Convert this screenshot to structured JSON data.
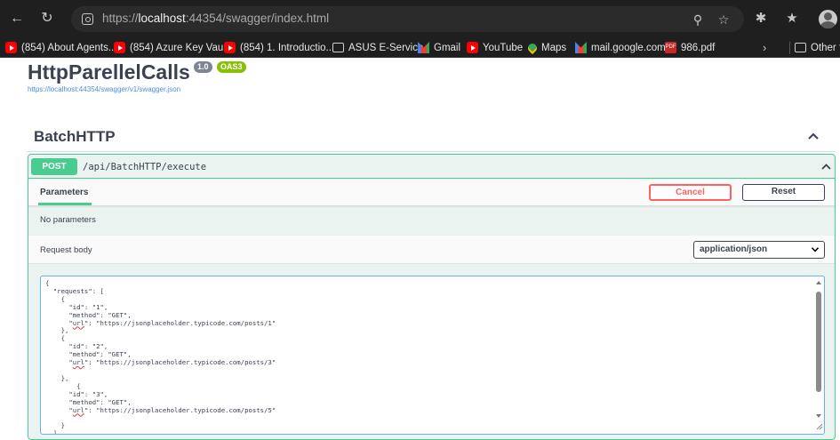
{
  "browser": {
    "url_scheme": "https://",
    "url_host": "localhost",
    "url_port": ":44354",
    "url_path": "/swagger/index.html",
    "bookmarks": [
      {
        "label": "(854) About Agents...",
        "icon": "youtube-icon"
      },
      {
        "label": "(854) Azure Key Vau...",
        "icon": "youtube-icon"
      },
      {
        "label": "(854) 1. Introductio...",
        "icon": "youtube-icon"
      },
      {
        "label": "ASUS E-Service",
        "icon": "folder-icon"
      },
      {
        "label": "Gmail",
        "icon": "gmail-icon"
      },
      {
        "label": "YouTube",
        "icon": "youtube-icon"
      },
      {
        "label": "Maps",
        "icon": "maps-icon"
      },
      {
        "label": "mail.google.com",
        "icon": "gmail-icon"
      },
      {
        "label": "986.pdf",
        "icon": "pdf-icon"
      },
      {
        "label": "Other fa",
        "icon": "folder-icon"
      }
    ]
  },
  "api": {
    "title": "HttpParellelCalls",
    "version": "1.0",
    "oas_badge": "OAS3",
    "spec_url": "https://localhost:44354/swagger/v1/swagger.json"
  },
  "tag": {
    "name": "BatchHTTP"
  },
  "operation": {
    "method": "POST",
    "path": "/api/BatchHTTP/execute",
    "parameters_tab": "Parameters",
    "cancel_label": "Cancel",
    "reset_label": "Reset",
    "no_params": "No parameters",
    "request_body_label": "Request body",
    "content_type": "application/json"
  },
  "request_body": [
    "{",
    "  \"requests\": [",
    "    {",
    "      \"id\": \"1\",",
    "      \"method\": \"GET\",",
    "      \"url\": \"https://jsonplaceholder.typicode.com/posts/1\"",
    "    },",
    "    {",
    "      \"id\": \"2\",",
    "      \"method\": \"GET\",",
    "      \"url\": \"https://jsonplaceholder.typicode.com/posts/3\"",
    "",
    "    },",
    "        {",
    "      \"id\": \"3\",",
    "      \"method\": \"GET\",",
    "      \"url\": \"https://jsonplaceholder.typicode.com/posts/5\"",
    "",
    "    }",
    "  ]"
  ],
  "colors": {
    "post_green": "#49cc90",
    "cancel_red": "#ff6060",
    "editor_border": "#61affe",
    "text": "#3b4151"
  }
}
